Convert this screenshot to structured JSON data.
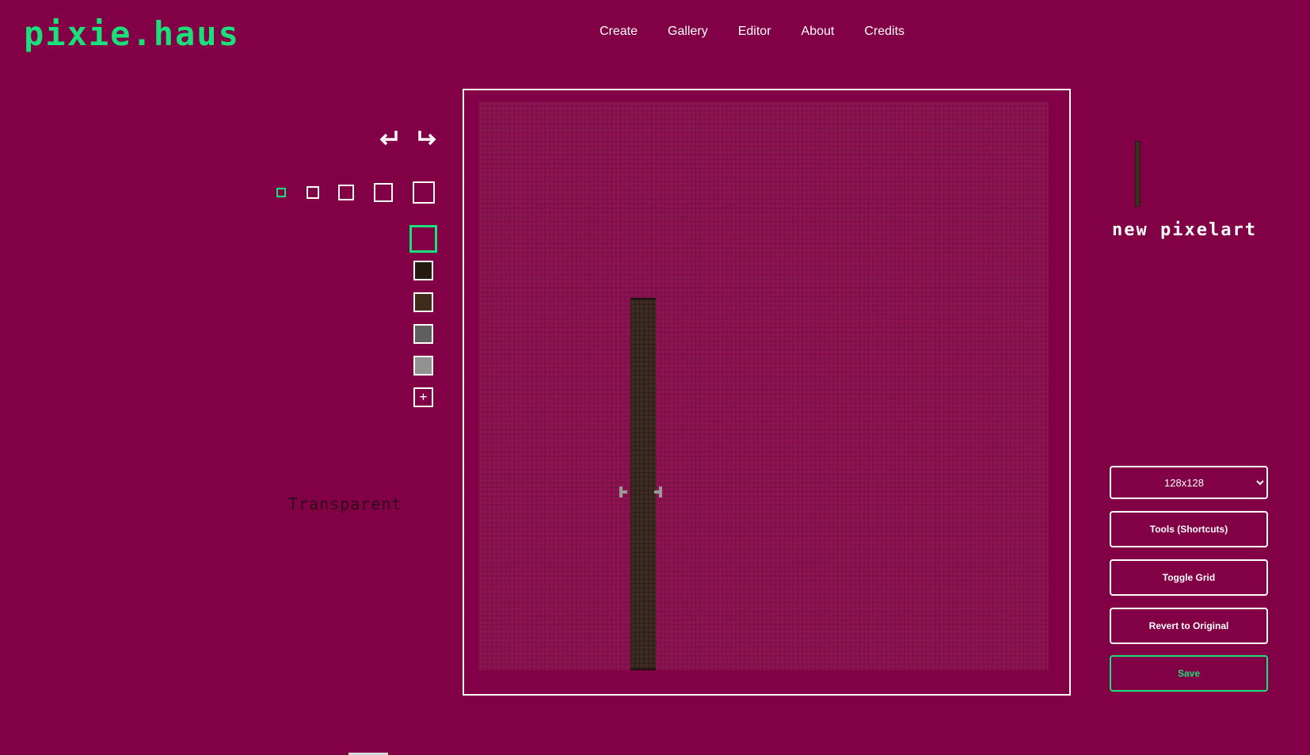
{
  "app": {
    "logo": "pixie.haus"
  },
  "nav": {
    "items": [
      "Create",
      "Gallery",
      "Editor",
      "About",
      "Credits"
    ]
  },
  "toolbar": {
    "undo_icon": "undo-arrow-icon",
    "redo_icon": "redo-arrow-icon",
    "brush_sizes": [
      1,
      2,
      3,
      4,
      5
    ],
    "active_brush_size": 1
  },
  "palette": {
    "active_color_name": "Transparent",
    "swatches": [
      "#251a10",
      "#3e2b1a",
      "#5f5f5f",
      "#929292"
    ],
    "add_label": "+"
  },
  "canvas": {
    "background": "#8e1352",
    "stroke_color": "#3e2b22"
  },
  "right_panel": {
    "title": "new pixelart",
    "canvas_size": "128x128",
    "size_options": [
      "128x128"
    ],
    "buttons": {
      "tools": "Tools (Shortcuts)",
      "toggle_grid": "Toggle Grid",
      "revert": "Revert to Original",
      "save": "Save"
    }
  },
  "colors": {
    "background": "#820045",
    "accent": "#19e07a",
    "text": "#ffffff"
  }
}
